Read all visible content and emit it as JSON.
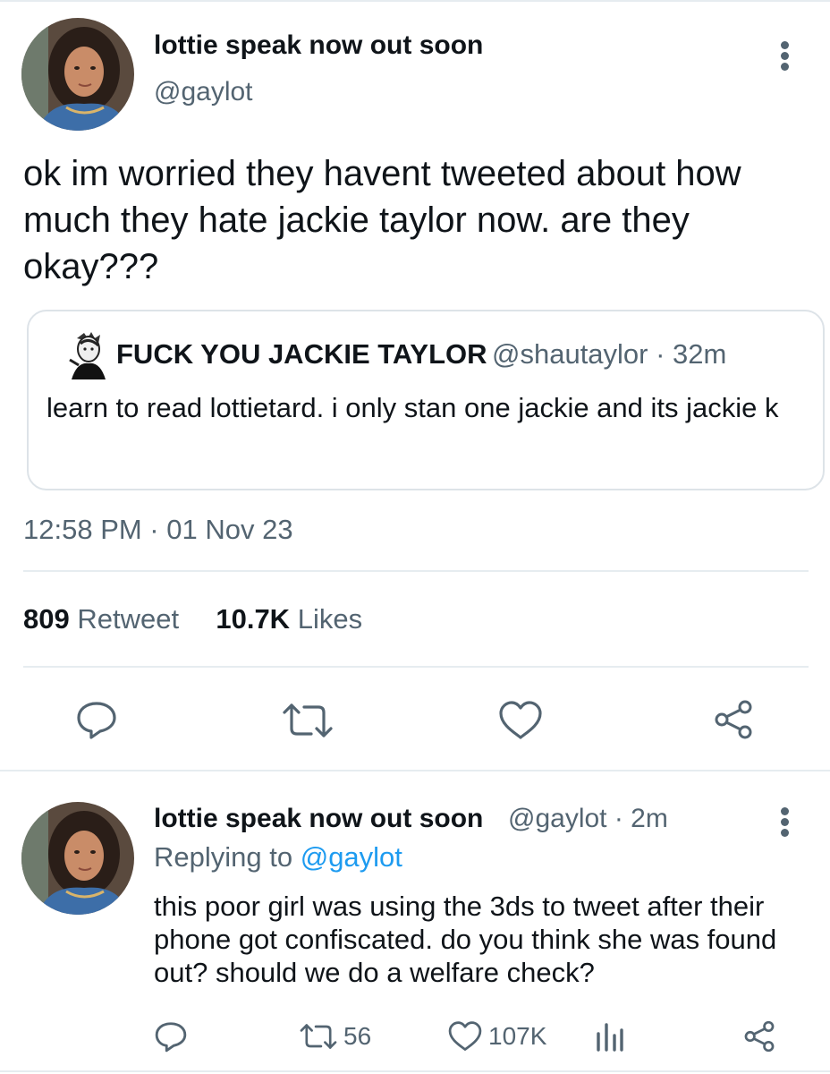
{
  "tweet": {
    "author": {
      "display_name": "lottie speak now out soon",
      "handle": "@gaylot"
    },
    "text": "ok im worried they havent tweeted about how much they hate jackie taylor now. are they okay???",
    "quoted_tweet": {
      "display_name": "FUCK YOU JACKIE TAYLOR",
      "handle_time": "@shautaylor · 32m",
      "text": "learn to read lottietard. i only stan one jackie and its jackie k"
    },
    "timestamp": "12:58 PM · 01 Nov 23",
    "stats": {
      "retweets_count": "809",
      "retweets_label": "Retweet",
      "likes_count": "10.7K",
      "likes_label": "Likes"
    },
    "actions": [
      "reply-icon",
      "retweet-icon",
      "like-icon",
      "share-icon"
    ]
  },
  "reply": {
    "display_name": "lottie speak now out soon",
    "handle_time": "@gaylot · 2m",
    "replying_prefix": "Replying to",
    "replying_mention": "@gaylot",
    "text": "this poor girl was using the 3ds to tweet after their phone got confiscated. do you think she was found out? should we do a welfare check?",
    "retweets": "56",
    "likes": "107K"
  },
  "colors": {
    "text_primary": "#0f1419",
    "text_secondary": "#536471",
    "link": "#1d9bf0",
    "border": "#e6ecf0"
  }
}
